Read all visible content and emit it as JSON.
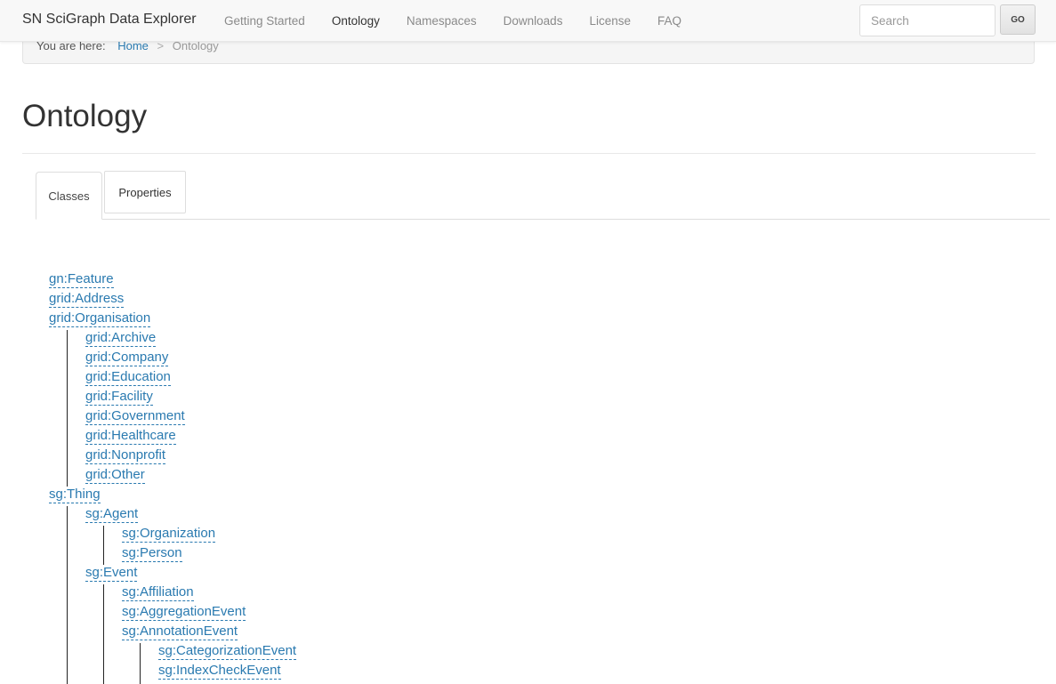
{
  "breadcrumb": {
    "label": "You are here:",
    "home": "Home",
    "separator": ">",
    "current": "Ontology"
  },
  "navbar": {
    "brand": "SN SciGraph Data Explorer",
    "links": [
      "Getting Started",
      "Ontology",
      "Namespaces",
      "Downloads",
      "License",
      "FAQ"
    ],
    "active": "Ontology",
    "search_placeholder": "Search",
    "go_label": "GO"
  },
  "page": {
    "title": "Ontology"
  },
  "tabs": {
    "classes": "Classes",
    "properties": "Properties",
    "active": "Classes"
  },
  "tree": [
    {
      "label": "gn:Feature",
      "depth": 0
    },
    {
      "label": "grid:Address",
      "depth": 0
    },
    {
      "label": "grid:Organisation",
      "depth": 0
    },
    {
      "label": "grid:Archive",
      "depth": 1
    },
    {
      "label": "grid:Company",
      "depth": 1
    },
    {
      "label": "grid:Education",
      "depth": 1
    },
    {
      "label": "grid:Facility",
      "depth": 1
    },
    {
      "label": "grid:Government",
      "depth": 1
    },
    {
      "label": "grid:Healthcare",
      "depth": 1
    },
    {
      "label": "grid:Nonprofit",
      "depth": 1
    },
    {
      "label": "grid:Other",
      "depth": 1
    },
    {
      "label": "sg:Thing",
      "depth": 0
    },
    {
      "label": "sg:Agent",
      "depth": 1
    },
    {
      "label": "sg:Organization",
      "depth": 2
    },
    {
      "label": "sg:Person",
      "depth": 2
    },
    {
      "label": "sg:Event",
      "depth": 1
    },
    {
      "label": "sg:Affiliation",
      "depth": 2
    },
    {
      "label": "sg:AggregationEvent",
      "depth": 2
    },
    {
      "label": "sg:AnnotationEvent",
      "depth": 2
    },
    {
      "label": "sg:CategorizationEvent",
      "depth": 3
    },
    {
      "label": "sg:IndexCheckEvent",
      "depth": 3
    }
  ],
  "colors": {
    "link": "#2a7ab0",
    "navbar_bg": "#f8f8f8",
    "tree_line": "#222222"
  }
}
